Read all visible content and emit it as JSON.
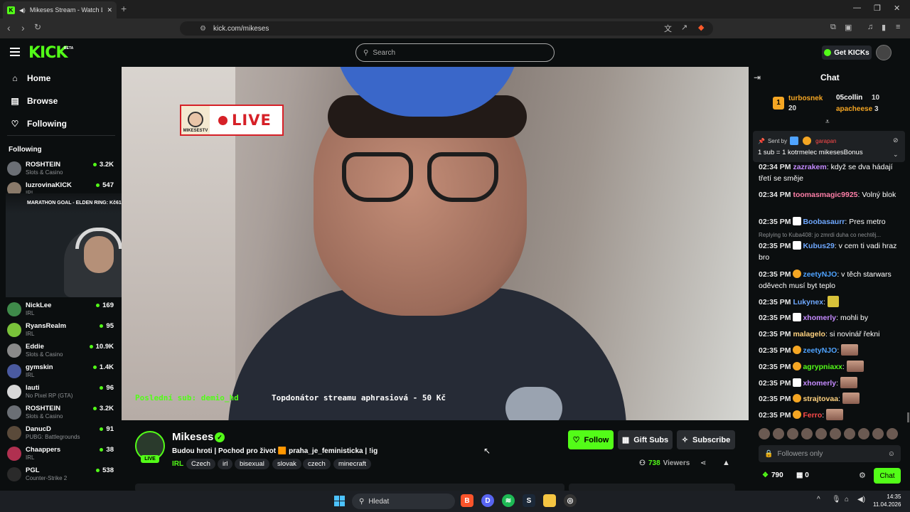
{
  "browser": {
    "tab_title": "Mikeses Stream - Watch Live",
    "url": "kick.com/mikeses"
  },
  "header": {
    "logo": "KICK",
    "logo_badge": "BETA",
    "search_placeholder": "Search",
    "get_kicks": "Get KICKs"
  },
  "sidebar": {
    "nav": [
      {
        "label": "Home",
        "icon": "home-icon"
      },
      {
        "label": "Browse",
        "icon": "browse-icon"
      },
      {
        "label": "Following",
        "icon": "heart-icon"
      }
    ],
    "following_label": "Following",
    "channels": [
      {
        "name": "ROSHTEIN",
        "category": "Slots & Casino",
        "viewers": "3.2K",
        "color": "#6b6f75"
      },
      {
        "name": "luzrovinaKICK",
        "category": "IRL",
        "viewers": "547",
        "color": "#8a7a6a"
      },
      {
        "name": "NickLee",
        "category": "IRL",
        "viewers": "169",
        "color": "#3f8a4a"
      },
      {
        "name": "RyansRealm",
        "category": "IRL",
        "viewers": "95",
        "color": "#7ac23a"
      },
      {
        "name": "Eddie",
        "category": "Slots & Casino",
        "viewers": "10.9K",
        "color": "#8a8a8a"
      },
      {
        "name": "gymskin",
        "category": "IRL",
        "viewers": "1.4K",
        "color": "#4a5aa0"
      },
      {
        "name": "lauti",
        "category": "No Pixel RP (GTA)",
        "viewers": "96",
        "color": "#d8d8d8"
      },
      {
        "name": "ROSHTEIN",
        "category": "Slots & Casino",
        "viewers": "3.2K",
        "color": "#6b6f75"
      },
      {
        "name": "DanucD",
        "category": "PUBG: Battlegrounds",
        "viewers": "91",
        "color": "#5a4a3a"
      },
      {
        "name": "Chaappers",
        "category": "IRL",
        "viewers": "38",
        "color": "#b03050"
      },
      {
        "name": "PGL",
        "category": "Counter-Strike 2",
        "viewers": "538",
        "color": "#2a2a2a"
      }
    ]
  },
  "miniplayer": {
    "goal_text": "MARATHON GOAL - ELDEN RING: Kč617/Kč5,000"
  },
  "video": {
    "live_badge_logo": "MIKESESTV",
    "live_badge_text": "LIVE",
    "overlay_last_sub": "Poslední sub: demio_hd",
    "overlay_top_donor": "Topdonátor streamu aphrasiová - 50 Kč"
  },
  "stream": {
    "channel_name": "Mikeses",
    "live_tag": "LIVE",
    "title": "Budou hroti | Pochod pro život 🟧 praha_je_feministicka | !ig",
    "category": "IRL",
    "tags": [
      "Czech",
      "irl",
      "bisexual",
      "slovak",
      "czech",
      "minecraft"
    ],
    "follow_label": "Follow",
    "gift_label": "Gift Subs",
    "subscribe_label": "Subscribe",
    "viewer_count": "738",
    "viewers_label": "Viewers"
  },
  "chat": {
    "title": "Chat",
    "leaderboard": [
      {
        "name": "turbosnek",
        "count": "20",
        "color": "#f5a623"
      },
      {
        "name": "05collin",
        "count": "10",
        "color": "#ffffff"
      },
      {
        "name": "apacheese",
        "count": "3",
        "color": "#f5a623"
      }
    ],
    "pinned_sent_by": "Sent by",
    "pinned_user": "garapan",
    "pinned_message": "1 sub = 1 kotrmelec mikesesBonus",
    "reply_hint": "Replying to Kuba408: jo zmrdi duha co nechtěj...",
    "messages": [
      {
        "time": "02:34 PM",
        "user": "zazrakem",
        "color": "#c58bff",
        "text": "když se dva hádají třetí se směje"
      },
      {
        "time": "02:34 PM",
        "user": "toomasmagic9925",
        "color": "#ff7fa8",
        "text": "Volný blok"
      },
      {
        "time": "02:35 PM",
        "user": "Boobasaurr",
        "color": "#6fa8ff",
        "text": "Pres metro"
      },
      {
        "time": "02:35 PM",
        "user": "Kubus29",
        "color": "#6fa8ff",
        "text": "v cem ti vadi hraz bro"
      },
      {
        "time": "02:35 PM",
        "user": "zeetyNJO",
        "color": "#4fa3ff",
        "text": "v těch starwars oděvech musí byt teplo"
      },
      {
        "time": "02:35 PM",
        "user": "Lukynex",
        "color": "#6fa8ff",
        "text": ""
      },
      {
        "time": "02:35 PM",
        "user": "xhomerly",
        "color": "#c58bff",
        "text": "mohli by"
      },
      {
        "time": "02:35 PM",
        "user": "malagelo",
        "color": "#ffd27f",
        "text": "si novinář řekni"
      },
      {
        "time": "02:35 PM",
        "user": "zeetyNJO",
        "color": "#4fa3ff",
        "text": ""
      },
      {
        "time": "02:35 PM",
        "user": "agrypniaxx",
        "color": "#53fc18",
        "text": ""
      },
      {
        "time": "02:35 PM",
        "user": "xhomerly",
        "color": "#c58bff",
        "text": ""
      },
      {
        "time": "02:35 PM",
        "user": "strajtovaa",
        "color": "#ffd27f",
        "text": ""
      },
      {
        "time": "02:35 PM",
        "user": "Ferro",
        "color": "#ff4a4a",
        "text": ""
      }
    ],
    "input_placeholder": "Followers only",
    "points": "790",
    "gift_count": "0",
    "chat_button": "Chat"
  },
  "taskbar": {
    "search_placeholder": "Hledat",
    "time": "14:35",
    "date": "11.04.2026"
  },
  "colors": {
    "brand": "#53fc18",
    "background": "#0b0e0f",
    "live_red": "#d62027"
  }
}
